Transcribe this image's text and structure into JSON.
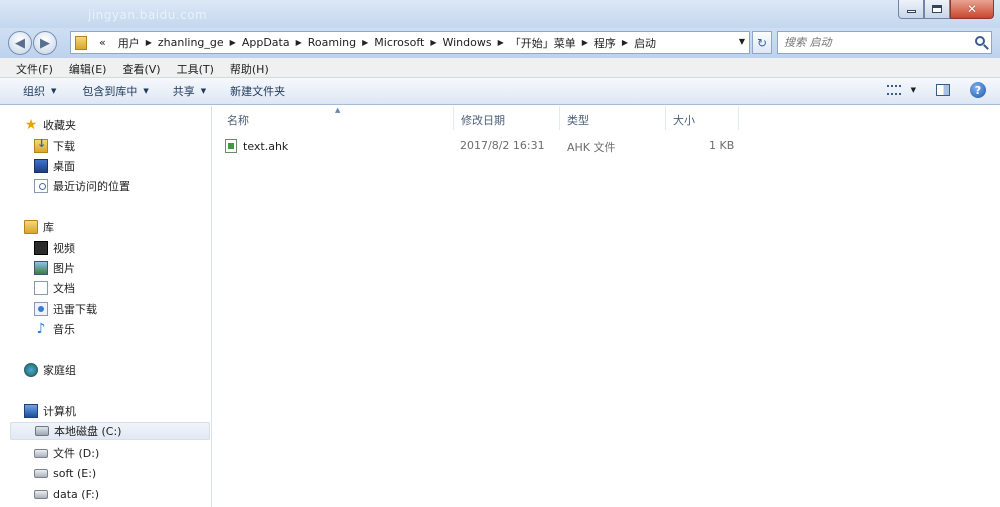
{
  "window": {
    "watermark": "jingyan.baidu.com",
    "minimize": "minimize",
    "maximize": "maximize",
    "close": "✕"
  },
  "address": {
    "overflow": "«",
    "crumbs": [
      "用户",
      "zhanling_ge",
      "AppData",
      "Roaming",
      "Microsoft",
      "Windows",
      "「开始」菜单",
      "程序",
      "启动"
    ],
    "search_placeholder": "搜索 启动"
  },
  "menubar": [
    "文件(F)",
    "编辑(E)",
    "查看(V)",
    "工具(T)",
    "帮助(H)"
  ],
  "toolbar": {
    "organize": "组织",
    "include_library": "包含到库中",
    "share": "共享",
    "new_folder": "新建文件夹"
  },
  "nav": {
    "favorites": "收藏夹",
    "favorites_items": [
      "下载",
      "桌面",
      "最近访问的位置"
    ],
    "libraries": "库",
    "library_items": [
      "视频",
      "图片",
      "文档",
      "迅雷下载",
      "音乐"
    ],
    "homegroup": "家庭组",
    "computer": "计算机",
    "drives": [
      "本地磁盘 (C:)",
      "文件 (D:)",
      "soft (E:)",
      "data (F:)"
    ]
  },
  "columns": [
    "名称",
    "修改日期",
    "类型",
    "大小"
  ],
  "files": [
    {
      "name": "text.ahk",
      "modified": "2017/8/2 16:31",
      "type": "AHK 文件",
      "size": "1 KB"
    }
  ],
  "colors": {
    "accent": "#1e395b",
    "titlebar": "#c4d7ee",
    "selection": "#e2e9f3"
  }
}
